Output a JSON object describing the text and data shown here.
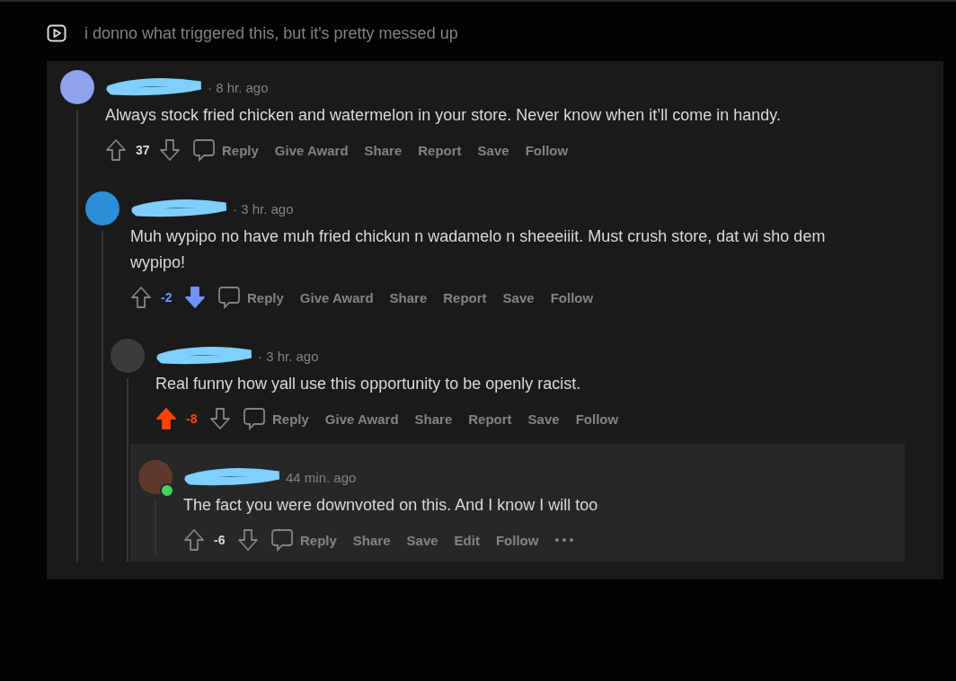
{
  "post": {
    "title": "i donno what triggered this, but it's pretty messed up"
  },
  "comments": [
    {
      "time": "· 8 hr. ago",
      "body": "Always stock fried chicken and watermelon in your store. Never know when it’ll come in handy.",
      "score": "37",
      "actions": [
        "Reply",
        "Give Award",
        "Share",
        "Report",
        "Save",
        "Follow"
      ],
      "children": [
        {
          "time": "· 3 hr. ago",
          "body": "Muh wypipo no have muh fried chickun n wadamelo n sheeeiiit. Must crush store, dat wi sho dem wypipo!",
          "score": "-2",
          "downvoted": true,
          "actions": [
            "Reply",
            "Give Award",
            "Share",
            "Report",
            "Save",
            "Follow"
          ],
          "children": [
            {
              "time": "· 3 hr. ago",
              "body": "Real funny how yall use this opportunity to be openly racist.",
              "score": "-8",
              "upvoted": true,
              "actions": [
                "Reply",
                "Give Award",
                "Share",
                "Report",
                "Save",
                "Follow"
              ],
              "children": [
                {
                  "online": true,
                  "highlighted": true,
                  "more_menu": true,
                  "time": "44 min. ago",
                  "body": "The fact you were downvoted on this. And I know I will too",
                  "score": "-6",
                  "actions": [
                    "Reply",
                    "Share",
                    "Save",
                    "Edit",
                    "Follow"
                  ]
                }
              ]
            }
          ]
        }
      ]
    }
  ]
}
